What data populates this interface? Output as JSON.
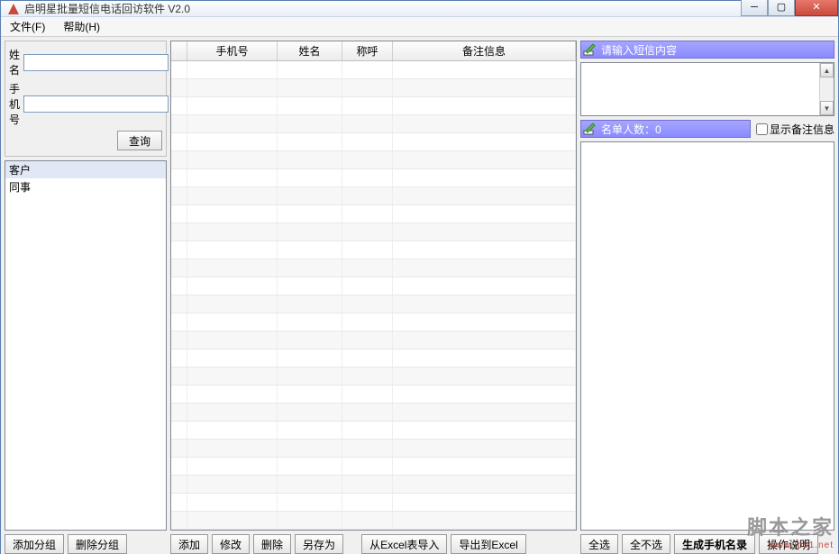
{
  "window": {
    "title": "启明星批量短信电话回访软件 V2.0"
  },
  "menu": {
    "file": "文件(F)",
    "help": "帮助(H)"
  },
  "search": {
    "name_label": "姓 名",
    "phone_label": "手机号",
    "name_value": "",
    "phone_value": "",
    "query_btn": "查询"
  },
  "groups": {
    "items": [
      "客户",
      "同事"
    ]
  },
  "grid": {
    "headers": {
      "phone": "手机号",
      "name": "姓名",
      "salutation": "称呼",
      "note": "备注信息"
    }
  },
  "sms": {
    "header": "请输入短信内容"
  },
  "namelist": {
    "header": "名单人数：0",
    "show_note_label": "显示备注信息",
    "show_note_checked": false
  },
  "buttons": {
    "add_group": "添加分组",
    "del_group": "删除分组",
    "add": "添加",
    "edit": "修改",
    "delete": "删除",
    "save_as": "另存为",
    "import_excel": "从Excel表导入",
    "export_excel": "导出到Excel",
    "select_all": "全选",
    "select_none": "全不选",
    "gen_phone": "生成手机名录",
    "help": "操作说明"
  },
  "watermark": {
    "main": "脚本之家",
    "sub": "www.jb51.net"
  }
}
